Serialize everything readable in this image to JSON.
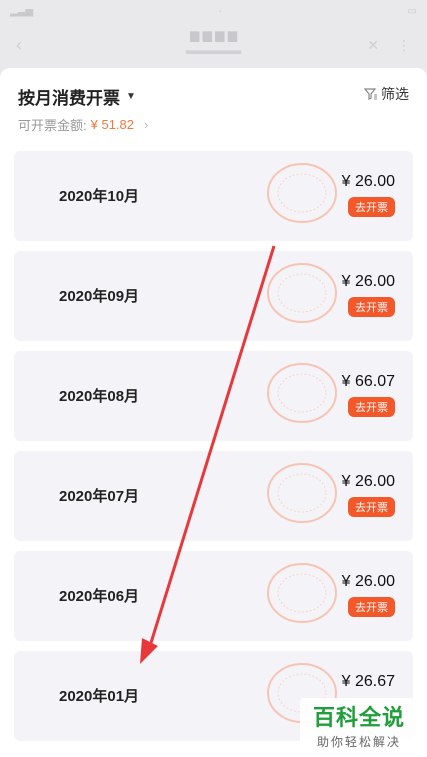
{
  "header": {
    "title": "按月消费开票",
    "filter_label": "筛选",
    "amount_label": "可开票金额:",
    "amount_value": "¥ 51.82"
  },
  "cards": [
    {
      "month": "2020年10月",
      "price": "¥ 26.00",
      "button": "去开票"
    },
    {
      "month": "2020年09月",
      "price": "¥ 26.00",
      "button": "去开票"
    },
    {
      "month": "2020年08月",
      "price": "¥ 66.07",
      "button": "去开票"
    },
    {
      "month": "2020年07月",
      "price": "¥ 26.00",
      "button": "去开票"
    },
    {
      "month": "2020年06月",
      "price": "¥ 26.00",
      "button": "去开票"
    },
    {
      "month": "2020年01月",
      "price": "¥ 26.67",
      "button": ""
    }
  ],
  "watermark": {
    "main": "百科全说",
    "sub": "助你轻松解决"
  },
  "colors": {
    "accent_orange": "#f2582a",
    "amount_orange": "#f07a3a",
    "arrow_red": "#e8383c",
    "watermark_green": "#1f9e3a"
  }
}
